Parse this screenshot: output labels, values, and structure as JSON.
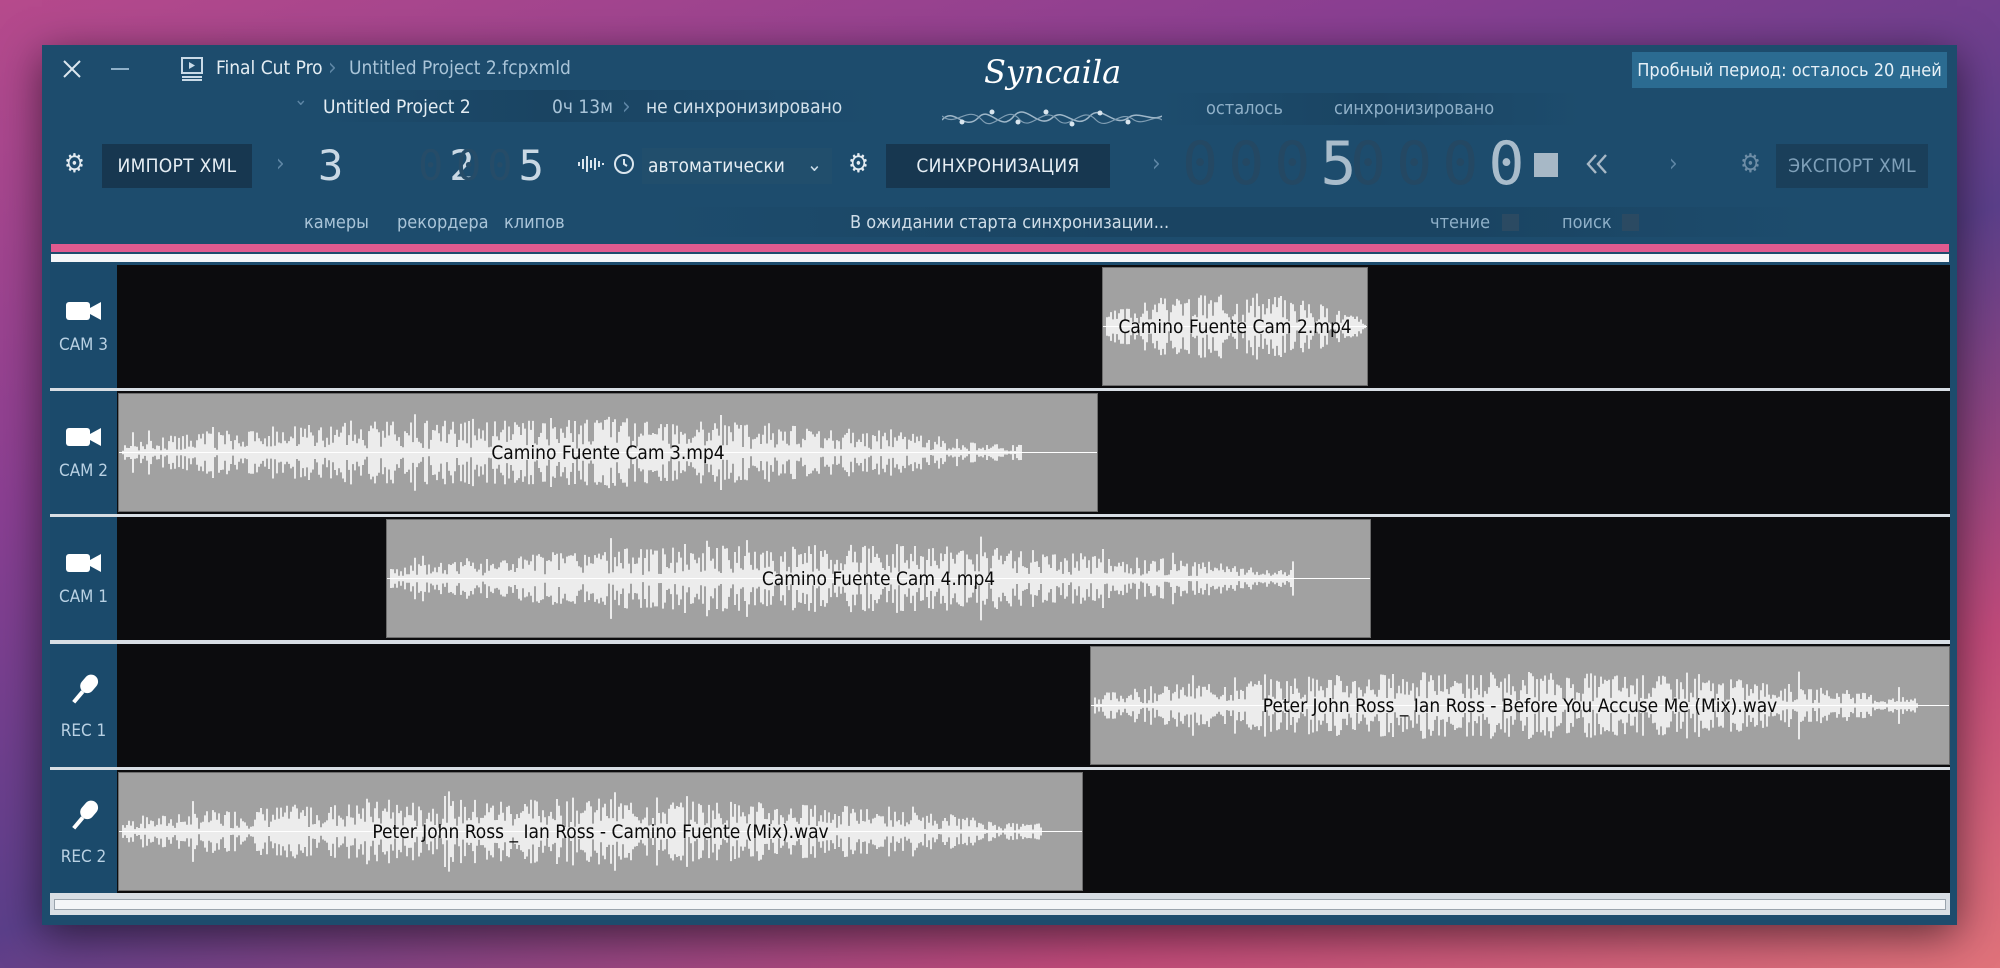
{
  "breadcrumb": {
    "app": "Final Cut Pro",
    "file": "Untitled Project 2.fcpxmld"
  },
  "project": {
    "name": "Untitled Project 2",
    "duration": "0ч 13м",
    "status": "не синхронизировано"
  },
  "brand": {
    "logo_text": "Syncaila"
  },
  "trial": {
    "label": "Пробный период: осталось 20 дней"
  },
  "stats_headers": {
    "remaining": "осталось",
    "synced": "синхронизировано"
  },
  "toolbar": {
    "import_label": "ИМПОРТ XML",
    "sync_label": "СИНХРОНИЗАЦИЯ",
    "export_label": "ЭКСПОРТ XML",
    "mode_value": "автоматически"
  },
  "counters": {
    "cameras": "3",
    "recorders": "2",
    "clips": "5",
    "cameras_label": "камеры",
    "recorders_label": "рекордера",
    "clips_label": "клипов",
    "remaining_value": "5",
    "synced_value": "0",
    "remaining_ghost": "000",
    "synced_ghost": "000",
    "clips_ghost": "00"
  },
  "status_text": "В ожидании старта синхронизации...",
  "toggles": {
    "read": "чтение",
    "seek": "поиск"
  },
  "colors": {
    "accent": "#e05a8f",
    "panel": "#1d4c6d",
    "clip": "#a1a1a1"
  },
  "tracks": [
    {
      "label": "CAM 3",
      "icon": "camera-icon",
      "clip": "Camino Fuente Cam 2.mp4"
    },
    {
      "label": "CAM 2",
      "icon": "camera-icon",
      "clip": "Camino Fuente Cam 3.mp4"
    },
    {
      "label": "CAM 1",
      "icon": "camera-icon",
      "clip": "Camino Fuente Cam 4.mp4"
    },
    {
      "label": "REC 1",
      "icon": "microphone-icon",
      "clip": "Peter John Ross _ Ian Ross - Before You Accuse Me (Mix).wav"
    },
    {
      "label": "REC 2",
      "icon": "microphone-icon",
      "clip": "Peter John Ross _ Ian Ross - Camino Fuente (Mix).wav"
    }
  ]
}
